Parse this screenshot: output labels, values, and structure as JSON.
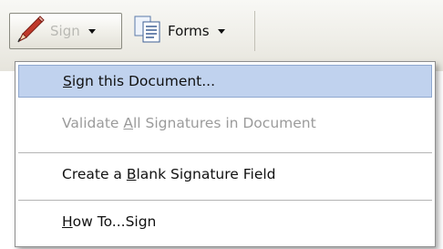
{
  "toolbar": {
    "sign_button": {
      "label": "Sign",
      "icon": "pen-icon",
      "icon_color": "#c0392b",
      "label_color": "#b9b9b4"
    },
    "forms_button": {
      "label": "Forms",
      "icon": "forms-icon"
    }
  },
  "menu": {
    "items": [
      {
        "pre": "",
        "mn": "S",
        "post": "ign this Document...",
        "highlighted": true,
        "disabled": false
      },
      {
        "pre": "Validate ",
        "mn": "A",
        "post": "ll Signatures in Document",
        "highlighted": false,
        "disabled": true
      },
      {
        "pre": "Create a ",
        "mn": "B",
        "post": "lank Signature Field",
        "highlighted": false,
        "disabled": false
      },
      {
        "pre": "",
        "mn": "H",
        "post": "ow To...Sign",
        "highlighted": false,
        "disabled": false
      }
    ],
    "highlight_color": "#c0d2ee"
  }
}
